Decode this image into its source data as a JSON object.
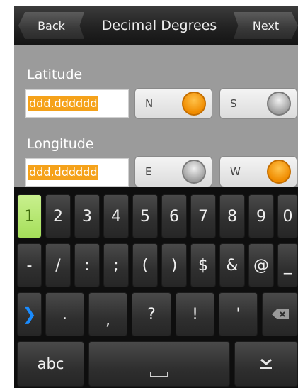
{
  "header": {
    "back_label": "Back",
    "title": "Decimal Degrees",
    "next_label": "Next"
  },
  "latitude": {
    "label": "Latitude",
    "value": "ddd.dddddd",
    "options": [
      {
        "label": "N",
        "selected": true
      },
      {
        "label": "S",
        "selected": false
      }
    ]
  },
  "longitude": {
    "label": "Longitude",
    "value": "ddd.dddddd",
    "options": [
      {
        "label": "E",
        "selected": false
      },
      {
        "label": "W",
        "selected": true
      }
    ]
  },
  "keyboard": {
    "row1": [
      "1",
      "2",
      "3",
      "4",
      "5",
      "6",
      "7",
      "8",
      "9",
      "0"
    ],
    "row2": [
      "-",
      "/",
      ":",
      ";",
      "(",
      ")",
      "$",
      "&",
      "@",
      "_"
    ],
    "row3": [
      ".",
      ",",
      "?",
      "!",
      "'"
    ],
    "abc_label": "abc",
    "space_icon": "space-bar-icon",
    "tab_icon": "chevron-right-icon",
    "backspace_icon": "backspace-icon",
    "hide_icon": "hide-keyboard-icon"
  },
  "colors": {
    "accent_orange": "#f5a21a",
    "active_key": "#b5e870",
    "tab_blue": "#1a8cff"
  }
}
